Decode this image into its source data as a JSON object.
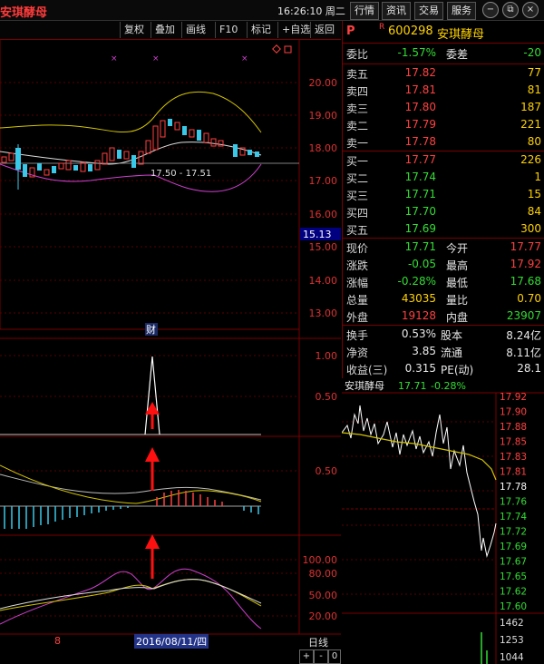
{
  "app": {
    "title": "安琪酵母",
    "clock": "16:26:10 周二"
  },
  "top_buttons": [
    "行情",
    "资讯",
    "交易",
    "服务"
  ],
  "window_buttons": [
    "−",
    "⧉",
    "×"
  ],
  "toolbar": [
    "复权",
    "叠加",
    "画线",
    "F10",
    "标记",
    "+自选",
    "返回"
  ],
  "chart": {
    "price_axis": [
      "20.00",
      "19.00",
      "18.00",
      "17.00",
      "16.00",
      "15.00",
      "14.00",
      "13.00"
    ],
    "current_price_tag": "15.13",
    "range_label": "17.50 - 17.51",
    "event_marker": "财",
    "ind1_axis": [
      "1.00",
      "0.50"
    ],
    "ind2_axis": [
      "0.50"
    ],
    "ind3_axis": [
      "100.00",
      "80.00",
      "50.00",
      "20.00"
    ],
    "date_label": "2016/08/11/四",
    "left_number": "8",
    "period_label": "日线",
    "zoom_buttons": [
      "+",
      "-",
      "0"
    ]
  },
  "quote": {
    "flag": "P",
    "r_mark": "R",
    "code": "600298",
    "name": "安琪酵母",
    "ratio": {
      "label": "委比",
      "value": "-1.57%",
      "label2": "委差",
      "value2": "-20"
    },
    "asks": [
      {
        "label": "卖五",
        "price": "17.82",
        "vol": "77"
      },
      {
        "label": "卖四",
        "price": "17.81",
        "vol": "81"
      },
      {
        "label": "卖三",
        "price": "17.80",
        "vol": "187"
      },
      {
        "label": "卖二",
        "price": "17.79",
        "vol": "221"
      },
      {
        "label": "卖一",
        "price": "17.78",
        "vol": "80"
      }
    ],
    "bids": [
      {
        "label": "买一",
        "price": "17.77",
        "vol": "226"
      },
      {
        "label": "买二",
        "price": "17.74",
        "vol": "1"
      },
      {
        "label": "买三",
        "price": "17.71",
        "vol": "15"
      },
      {
        "label": "买四",
        "price": "17.70",
        "vol": "84"
      },
      {
        "label": "买五",
        "price": "17.69",
        "vol": "300"
      }
    ],
    "stats": [
      {
        "l1": "现价",
        "v1": "17.71",
        "c1": "green",
        "l2": "今开",
        "v2": "17.77",
        "c2": "red"
      },
      {
        "l1": "涨跌",
        "v1": "-0.05",
        "c1": "green",
        "l2": "最高",
        "v2": "17.92",
        "c2": "red"
      },
      {
        "l1": "涨幅",
        "v1": "-0.28%",
        "c1": "green",
        "l2": "最低",
        "v2": "17.68",
        "c2": "green"
      },
      {
        "l1": "总量",
        "v1": "43035",
        "c1": "yellow",
        "l2": "量比",
        "v2": "0.70",
        "c2": "yellow"
      },
      {
        "l1": "外盘",
        "v1": "19128",
        "c1": "red",
        "l2": "内盘",
        "v2": "23907",
        "c2": "green"
      }
    ],
    "fundamentals": [
      {
        "l1": "换手",
        "v1": "0.53%",
        "l2": "股本",
        "v2": "8.24亿"
      },
      {
        "l1": "净资",
        "v1": "3.85",
        "l2": "流通",
        "v2": "8.11亿"
      },
      {
        "l1": "收益(三)",
        "v1": "0.315",
        "l2": "PE(动)",
        "v2": "28.1"
      }
    ]
  },
  "mini": {
    "title": "安琪酵母",
    "price": "17.71",
    "change": "-0.28%",
    "axis": [
      "17.92",
      "17.90",
      "17.88",
      "17.85",
      "17.83",
      "17.81",
      "17.78",
      "17.76",
      "17.74",
      "17.72",
      "17.69",
      "17.67",
      "17.65",
      "17.62",
      "17.60"
    ],
    "vol_axis": [
      "1462",
      "1253",
      "1044"
    ]
  },
  "colors": {
    "up": "#ff4040",
    "down": "#33dd33",
    "accent": "#7a0000",
    "yellow": "#ffd200"
  }
}
